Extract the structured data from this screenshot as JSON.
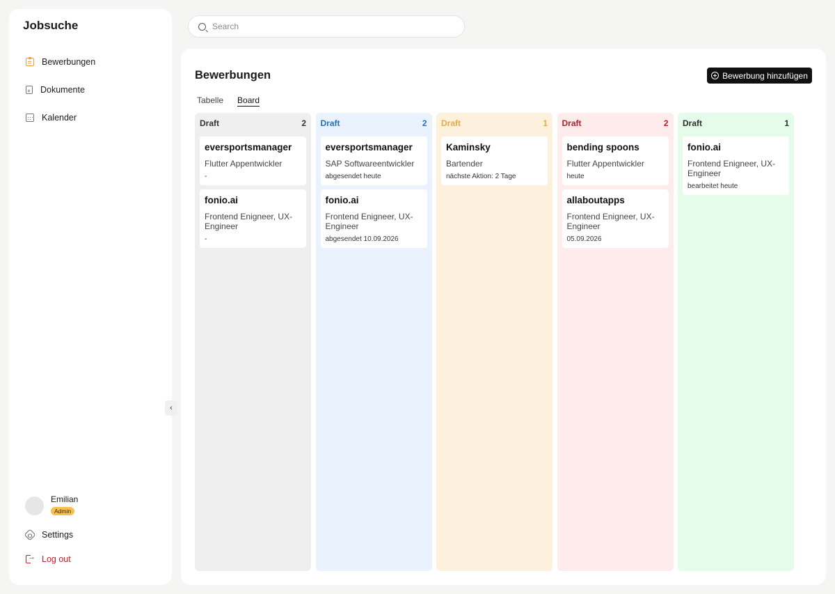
{
  "app": {
    "title": "Jobsuche"
  },
  "sidebar": {
    "items": [
      {
        "label": "Bewerbungen",
        "icon": "clipboard-icon"
      },
      {
        "label": "Dokumente",
        "icon": "document-icon"
      },
      {
        "label": "Kalender",
        "icon": "calendar-icon"
      }
    ],
    "user": {
      "name": "Emilian",
      "role": "Admin"
    },
    "settings_label": "Settings",
    "logout_label": "Log out",
    "collapse_glyph": "‹"
  },
  "search": {
    "placeholder": "Search",
    "value": ""
  },
  "main": {
    "title": "Bewerbungen",
    "add_button_label": "Bewerbung hinzufügen",
    "tabs": [
      {
        "label": "Tabelle",
        "active": false
      },
      {
        "label": "Board",
        "active": true
      }
    ]
  },
  "board": {
    "columns": [
      {
        "title": "Draft",
        "count": "2",
        "bg": "#efefef",
        "fg": "#333333",
        "cards": [
          {
            "company": "eversportsmanager",
            "role": "Flutter Appentwickler",
            "meta": "-"
          },
          {
            "company": "fonio.ai",
            "role": "Frontend Enigneer, UX-Engineer",
            "meta": "-"
          }
        ]
      },
      {
        "title": "Draft",
        "count": "2",
        "bg": "#eaf3fd",
        "fg": "#1f6fc2",
        "cards": [
          {
            "company": "eversportsmanager",
            "role": "SAP Softwareentwickler",
            "meta": "abgesendet heute"
          },
          {
            "company": "fonio.ai",
            "role": "Frontend Enigneer, UX-Engineer",
            "meta": "abgesendet 10.09.2026"
          }
        ]
      },
      {
        "title": "Draft",
        "count": "1",
        "bg": "#fdf1de",
        "fg": "#e8ac3c",
        "cards": [
          {
            "company": "Kaminsky",
            "role": "Bartender",
            "meta": "nächste Aktion: 2 Tage"
          }
        ]
      },
      {
        "title": "Draft",
        "count": "2",
        "bg": "#fdeceb",
        "fg": "#b0212b",
        "cards": [
          {
            "company": "bending spoons",
            "role": "Flutter Appentwickler",
            "meta": "heute"
          },
          {
            "company": "allaboutapps",
            "role": "Frontend Enigneer, UX-Engineer",
            "meta": "05.09.2026"
          }
        ]
      },
      {
        "title": "Draft",
        "count": "1",
        "bg": "#e6fcea",
        "fg": "#2e2e2e",
        "cards": [
          {
            "company": "fonio.ai",
            "role": "Frontend Enigneer, UX-Engineer",
            "meta": "bearbeitet heute"
          }
        ]
      }
    ]
  }
}
